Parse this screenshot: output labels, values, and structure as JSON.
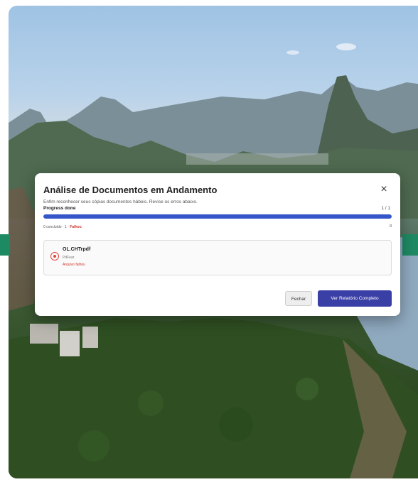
{
  "modal": {
    "title": "Análise de Documentos em Andamento",
    "close_glyph": "×",
    "description": "Enfim reconhecer seus cópias documentos hábeis. Revise os erros abaixo.",
    "progress_label": "Progress done",
    "progress_count": "1 / 1",
    "progress_fraction": 1.0,
    "status_prefix": "0 concluído · 1 ·",
    "status_fail": "Falhou",
    "status_right_value": "0",
    "file": {
      "icon": "error-circle-icon",
      "name": "OL.CHTrpdf",
      "type": "PdFear",
      "error": "Arquivo falhou"
    },
    "secondary_button": "Fechar",
    "primary_button": "Ver Relatório Completo"
  },
  "colors": {
    "accent": "#3a3fa6",
    "progress": "#3456c8",
    "error": "#d0342c",
    "side_stripe": "#1e8a64"
  }
}
